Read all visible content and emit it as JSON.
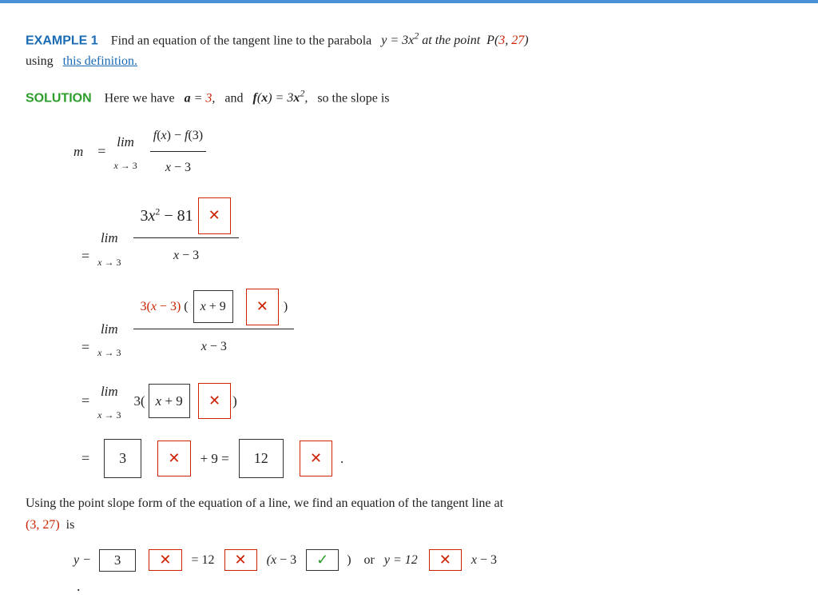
{
  "example": {
    "label": "EXAMPLE 1",
    "description": "Find an equation of the tangent line to the parabola",
    "equation": "y = 3x² at the point",
    "point": "P(3, 27)",
    "continuation": "using",
    "link_text": "this definition.",
    "solution_label": "SOLUTION",
    "solution_text": "Here we have",
    "a_val": "a = 3,",
    "and_text": "and",
    "fx_text": "f(x) = 3x²,",
    "slope_text": "so the slope is"
  },
  "math": {
    "m_label": "m",
    "eq1_lim": "lim",
    "eq1_arrow": "x → 3",
    "eq1_num": "f(x) − f(3)",
    "eq1_den": "x − 3",
    "eq2_lim": "lim",
    "eq2_arrow": "x → 3",
    "eq2_num": "3x² − 81",
    "eq2_den": "x − 3",
    "eq3_lim": "lim",
    "eq3_arrow": "x → 3",
    "eq3_num_outer": "3(x − 3)",
    "eq3_num_boxed": "x + 9",
    "eq3_den": "x − 3",
    "eq4_lim": "lim",
    "eq4_arrow": "x → 3",
    "eq4_coeff": "3",
    "eq4_boxed": "x + 9",
    "eq5_box1": "3",
    "eq5_plus9": "+ 9 =",
    "eq5_box2": "12"
  },
  "text_block": {
    "line1": "Using the point slope form of the equation of a line, we find an equation of the tangent line at",
    "point": "(3, 27)",
    "is_text": "is"
  },
  "final_eq": {
    "y_minus": "y −",
    "box1": "3",
    "equals1": "=",
    "box2": "12",
    "times": "(x −",
    "three": "3",
    "close": ")",
    "or": "or",
    "y_eq": "y =",
    "box3": "12",
    "x_minus": "x −",
    "three2": "3",
    "dot": "."
  },
  "icons": {
    "red_x": "✕",
    "green_check": "✓"
  }
}
